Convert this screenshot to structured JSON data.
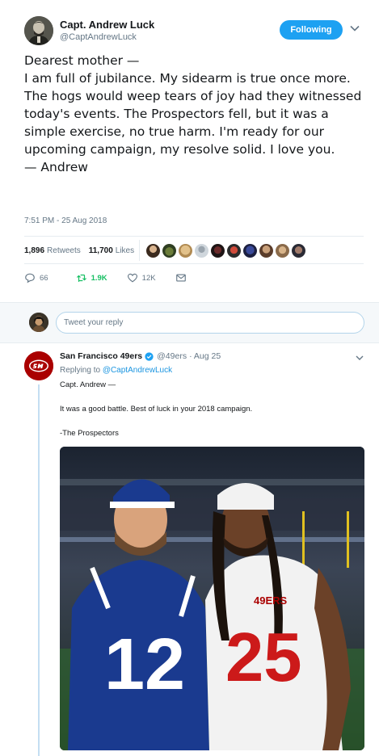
{
  "tweet": {
    "author_name": "Capt. Andrew Luck",
    "author_handle": "@CaptAndrewLuck",
    "follow_label": "Following",
    "text": "Dearest mother —\nI am full of jubilance. My sidearm is true once more. The hogs would weep tears of joy had they witnessed today's events. The Prospectors fell, but it was a simple exercise, no true harm. I'm ready for our upcoming campaign, my resolve solid. I love you.\n— Andrew",
    "timestamp": "7:51 PM - 25 Aug 2018",
    "retweets_count": "1,896",
    "retweets_label": "Retweets",
    "likes_count": "11,700",
    "likes_label": "Likes",
    "liker_avatars": [
      "avatar-1",
      "avatar-2",
      "avatar-3",
      "avatar-4",
      "avatar-5",
      "avatar-6",
      "avatar-7",
      "avatar-8",
      "avatar-9",
      "avatar-10"
    ],
    "actions": {
      "reply_icon": "reply-icon",
      "reply_count": "66",
      "retweet_icon": "retweet-icon",
      "retweet_count": "1.9K",
      "like_icon": "heart-icon",
      "like_count": "12K",
      "dm_icon": "envelope-icon"
    }
  },
  "reply_box": {
    "placeholder": "Tweet your reply"
  },
  "reply": {
    "author_name": "San Francisco 49ers",
    "author_handle": "@49ers",
    "date": "· Aug 25",
    "replying_prefix": "Replying to",
    "replying_to": "@CaptAndrewLuck",
    "line1": "Capt. Andrew —",
    "line2": "It was a good battle. Best of luck in your 2018 campaign.",
    "line3": "-The Prospectors",
    "photo": {
      "left_jersey_number": "12",
      "right_jersey_number": "25",
      "right_jersey_team": "49ERS"
    }
  },
  "colors": {
    "accent_blue": "#1da1f2",
    "retweet_green": "#17bf63",
    "colts_blue": "#1a3a8f",
    "niners_red": "#aa0000"
  }
}
